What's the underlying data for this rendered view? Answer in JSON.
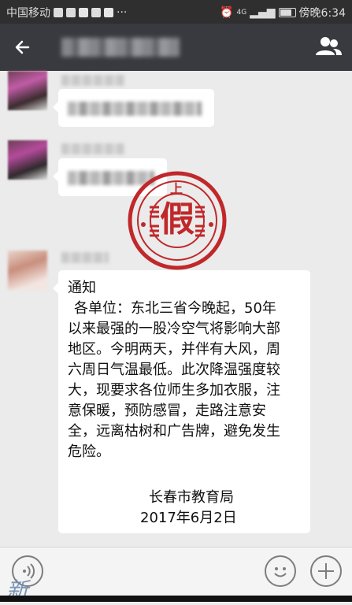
{
  "status_bar": {
    "carrier": "中国移动",
    "menu_glyph": "···",
    "network": "4G",
    "time": "傍晚6:34"
  },
  "header": {
    "back_icon": "arrow-left-icon",
    "group_icon": "people-icon"
  },
  "notice": {
    "heading": "通知",
    "lines": [
      "各单位：东北三省今晚起，50年",
      "以来最强的一股冷空气将影响大部",
      "地区。今明两天，并伴有大风，周",
      "六周日气温最低。此次降温强度较",
      "大，现要求各位师生多加衣服，注",
      "意保暖，预防感冒，走路注意安",
      "全，远离枯树和广告牌，避免发生",
      "危险。"
    ],
    "signature": "长春市教育局",
    "date": "2017年6月2日"
  },
  "stamp": {
    "top_char": "上",
    "center_char": "假",
    "color": "#c0282a"
  },
  "input_bar": {
    "voice_icon": "voice-icon",
    "emoji_icon": "emoji-icon",
    "plus_icon": "plus-icon"
  },
  "watermark": {
    "text": "新"
  }
}
